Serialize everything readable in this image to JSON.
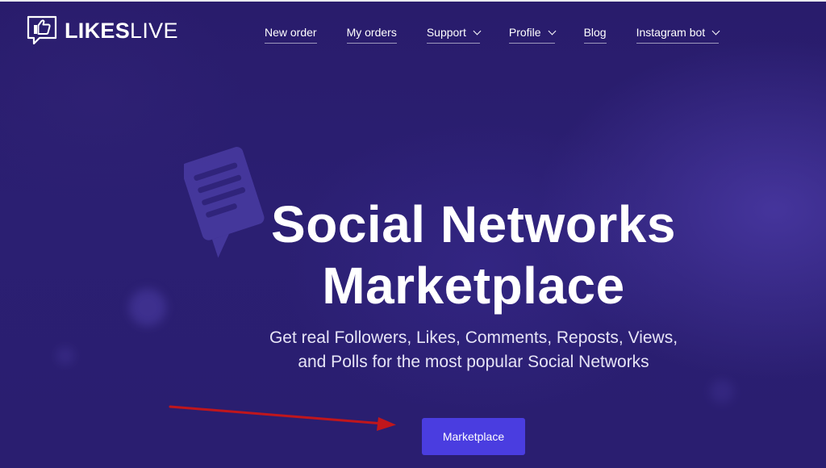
{
  "header": {
    "logo": {
      "bold": "LIKES",
      "light": "LIVE"
    },
    "nav": [
      {
        "label": "New order",
        "dropdown": false
      },
      {
        "label": "My orders",
        "dropdown": false
      },
      {
        "label": "Support",
        "dropdown": true
      },
      {
        "label": "Profile",
        "dropdown": true
      },
      {
        "label": "Blog",
        "dropdown": false
      },
      {
        "label": "Instagram bot",
        "dropdown": true
      }
    ]
  },
  "hero": {
    "title_line1": "Social Networks",
    "title_line2": "Marketplace",
    "subtitle_line1": "Get real Followers, Likes, Comments, Reposts, Views,",
    "subtitle_line2": "and Polls for the most popular Social Networks",
    "cta_label": "Marketplace"
  },
  "colors": {
    "background": "#2a1e70",
    "cta": "#4a3de0",
    "annotation_arrow": "#c0161c"
  },
  "icons": [
    "thumbs-up-icon",
    "chat-bubble-icon",
    "chevron-down-icon",
    "arrow-annotation"
  ]
}
